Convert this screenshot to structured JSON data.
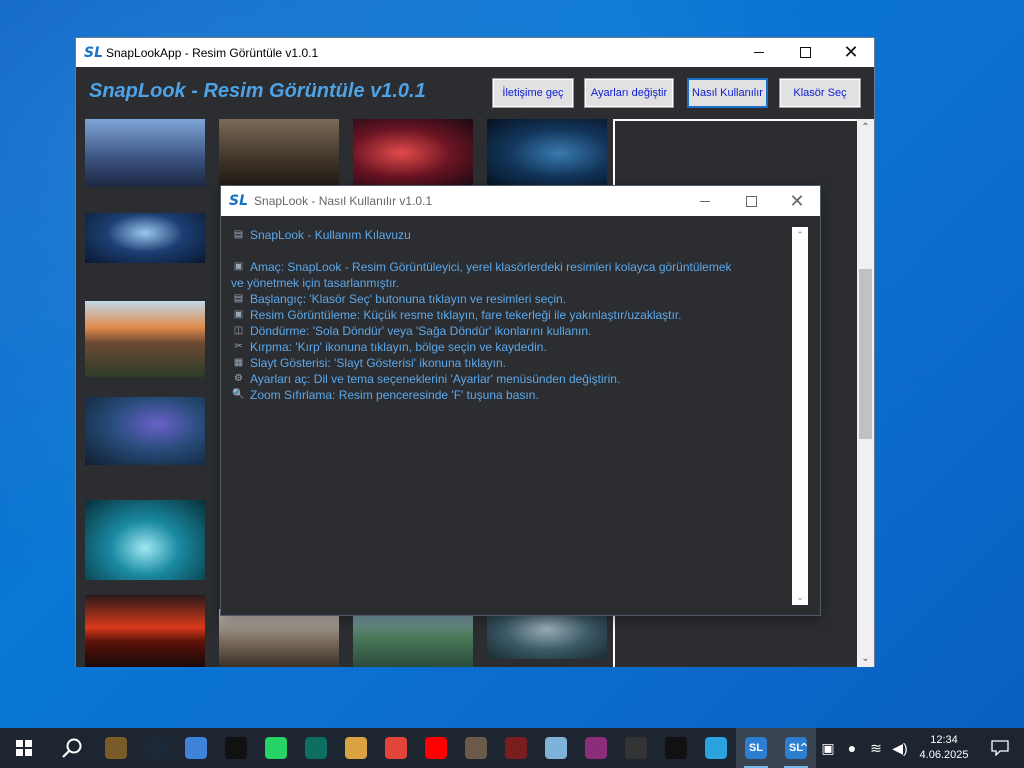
{
  "main_window": {
    "title": "SnapLookApp - Resim Görüntüle v1.0.1",
    "logo_text": "SL",
    "app_heading": "SnapLook - Resim Görüntüle v1.0.1",
    "buttons": {
      "contact": "İletişime geç",
      "settings": "Ayarları değiştir",
      "howto": "Nasıl Kullanılır",
      "choose_folder": "Klasör Seç"
    }
  },
  "help_window": {
    "title": "SnapLook - Nasıl Kullanılır v1.0.1",
    "logo_text": "SL",
    "lines": [
      {
        "icon": "book-icon",
        "glyph": "▤",
        "text": "SnapLook - Kullanım Kılavuzu"
      },
      {
        "icon": "",
        "glyph": "",
        "text": ""
      },
      {
        "icon": "purpose-icon",
        "glyph": "▣",
        "text": "Amaç: SnapLook - Resim Görüntüleyici, yerel klasörlerdeki resimleri kolayca görüntülemek"
      },
      {
        "icon": "",
        "glyph": "",
        "text": "ve yönetmek için tasarlanmıştır."
      },
      {
        "icon": "start-icon",
        "glyph": "▤",
        "text": "Başlangıç: 'Klasör Seç' butonuna tıklayın ve resimleri seçin."
      },
      {
        "icon": "view-icon",
        "glyph": "▣",
        "text": "Resim Görüntüleme: Küçük resme tıklayın, fare tekerleği ile yakınlaştır/uzaklaştır."
      },
      {
        "icon": "rotate-icon",
        "glyph": "◫",
        "text": "Döndürme: 'Sola Döndür' veya 'Sağa Döndür' ikonlarını kullanın."
      },
      {
        "icon": "scissors-icon",
        "glyph": "✂",
        "text": "Kırpma: 'Kırp' ikonuna tıklayın, bölge seçin ve kaydedin."
      },
      {
        "icon": "slideshow-icon",
        "glyph": "▦",
        "text": "Slayt Gösterisi: 'Slayt Gösterisi' ikonuna tıklayın."
      },
      {
        "icon": "gear-icon",
        "glyph": "⚙",
        "text": "Ayarları aç: Dil ve tema seçeneklerini 'Ayarlar' menüsünden değiştirin."
      },
      {
        "icon": "magnifier-icon",
        "glyph": "🔍",
        "text": "Zoom Sıfırlama: Resim penceresinde 'F' tuşuna basın."
      }
    ]
  },
  "taskbar": {
    "time": "12:34",
    "date": "4.06.2025",
    "pinned": [
      {
        "name": "film-icon",
        "label": "",
        "color": "#7a5c2a"
      },
      {
        "name": "steam-icon",
        "label": "",
        "color": "#1b2838"
      },
      {
        "name": "finder-icon",
        "label": "",
        "color": "#3f83d8"
      },
      {
        "name": "obs-icon",
        "label": "",
        "color": "#111111"
      },
      {
        "name": "whatsapp-icon",
        "label": "",
        "color": "#25d366"
      },
      {
        "name": "terminal-icon",
        "label": "",
        "color": "#0e6e62"
      },
      {
        "name": "paint-icon",
        "label": "",
        "color": "#d9a441"
      },
      {
        "name": "chrome-icon",
        "label": "",
        "color": "#e3453a"
      },
      {
        "name": "youtube-icon",
        "label": "",
        "color": "#ff0000"
      },
      {
        "name": "game-icon",
        "label": "",
        "color": "#6c5a48"
      },
      {
        "name": "eye-icon",
        "label": "",
        "color": "#7a1d1d"
      },
      {
        "name": "notes-icon",
        "label": "",
        "color": "#7fb2d8"
      },
      {
        "name": "archive-icon",
        "label": "",
        "color": "#8b2d7a"
      },
      {
        "name": "tool-icon",
        "label": "",
        "color": "#333333"
      },
      {
        "name": "github-icon",
        "label": "",
        "color": "#111111"
      },
      {
        "name": "telegram-icon",
        "label": "",
        "color": "#2aa3df"
      },
      {
        "name": "snaplook-icon",
        "label": "SL",
        "color": "#2c7fd0"
      },
      {
        "name": "snaplook-icon-2",
        "label": "SL",
        "color": "#2c7fd0"
      }
    ]
  },
  "colors": {
    "accent": "#4da3e6",
    "window_bg": "#2b2d31",
    "button_text": "#0c1dd0"
  }
}
